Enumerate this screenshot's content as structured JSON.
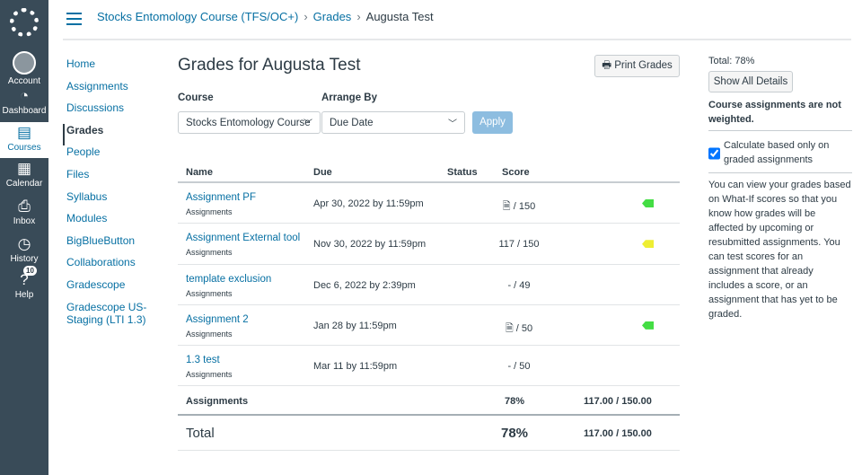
{
  "global_nav": [
    {
      "label": "Account",
      "icon": "account-icon"
    },
    {
      "label": "Dashboard",
      "icon": "dashboard-icon"
    },
    {
      "label": "Courses",
      "icon": "courses-icon",
      "active": true
    },
    {
      "label": "Calendar",
      "icon": "calendar-icon"
    },
    {
      "label": "Inbox",
      "icon": "inbox-icon"
    },
    {
      "label": "History",
      "icon": "history-icon"
    },
    {
      "label": "Help",
      "icon": "help-icon",
      "badge": "10"
    }
  ],
  "breadcrumb": [
    "Stocks Entomology Course (TFS/OC+)",
    "Grades",
    "Augusta Test"
  ],
  "course_nav": [
    "Home",
    "Assignments",
    "Discussions",
    "Grades",
    "People",
    "Files",
    "Syllabus",
    "Modules",
    "BigBlueButton",
    "Collaborations",
    "Gradescope",
    "Gradescope US-Staging (LTI 1.3)"
  ],
  "title": "Grades for Augusta Test",
  "print_label": "Print Grades",
  "course_label": "Course",
  "course_value": "Stocks Entomology Course",
  "arrange_label": "Arrange By",
  "arrange_value": "Due Date",
  "apply_label": "Apply",
  "columns": [
    "Name",
    "Due",
    "Status",
    "Score"
  ],
  "rows": [
    {
      "name": "Assignment PF",
      "cat": "Assignments",
      "due": "Apr 30, 2022 by 11:59pm",
      "score": "/ 150",
      "icon": true,
      "flag": "#44dd44"
    },
    {
      "name": "Assignment External tool",
      "cat": "Assignments",
      "due": "Nov 30, 2022 by 11:59pm",
      "score": "117 / 150",
      "flag": "#eeee33"
    },
    {
      "name": "template exclusion",
      "cat": "Assignments",
      "due": "Dec 6, 2022 by 2:39pm",
      "score": "- / 49"
    },
    {
      "name": "Assignment 2",
      "cat": "Assignments",
      "due": "Jan 28 by 11:59pm",
      "score": "/ 50",
      "icon": true,
      "flag": "#44dd44"
    },
    {
      "name": "1.3 test",
      "cat": "Assignments",
      "due": "Mar 11 by 11:59pm",
      "score": "- / 50"
    }
  ],
  "group_total": {
    "label": "Assignments",
    "pct": "78%",
    "pts": "117.00 / 150.00"
  },
  "total": {
    "label": "Total",
    "pct": "78%",
    "pts": "117.00 / 150.00"
  },
  "side": {
    "total": "Total: 78%",
    "show_all": "Show All Details",
    "weight_note": "Course assignments are not weighted.",
    "checkbox_label": "Calculate based only on graded assignments",
    "checked": true,
    "whatif": "You can view your grades based on What-If scores so that you know how grades will be affected by upcoming or resubmitted assignments. You can test scores for an assignment that already includes a score, or an assignment that has yet to be graded."
  }
}
